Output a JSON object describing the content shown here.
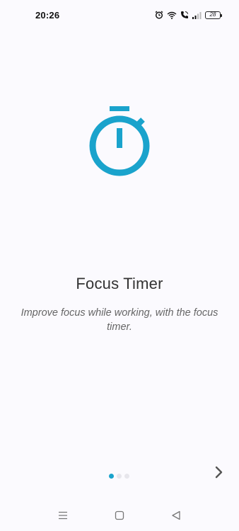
{
  "status_bar": {
    "time": "20:26",
    "battery_level": "28",
    "icons": [
      "alarm-icon",
      "wifi-icon",
      "call-icon",
      "signal-icon",
      "battery-icon"
    ]
  },
  "onboarding": {
    "icon": "stopwatch-icon",
    "title": "Focus Timer",
    "description": "Improve focus while working, with the focus timer.",
    "page_indicator": {
      "total": 3,
      "current": 1
    },
    "next_icon": "chevron-right-icon"
  },
  "nav_bar": {
    "icons": [
      "menu-icon",
      "home-icon",
      "back-icon"
    ]
  },
  "colors": {
    "accent": "#1aa3cc",
    "background": "#fbfafe",
    "dot_inactive": "#e7e6ec",
    "title_text": "#333333",
    "description_text": "#666666"
  }
}
